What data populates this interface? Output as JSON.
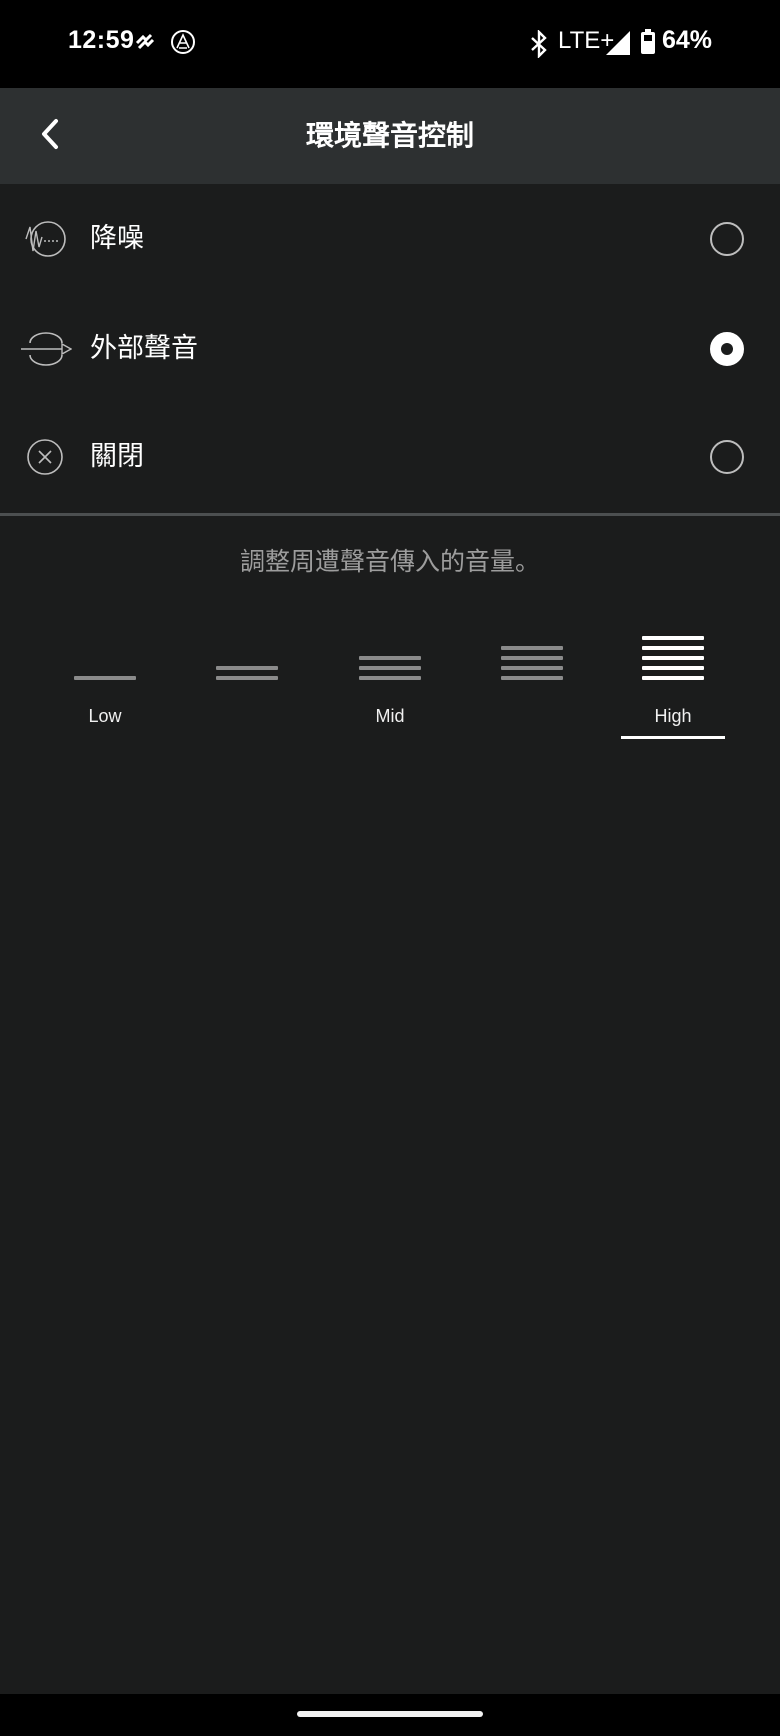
{
  "status_bar": {
    "time": "12:59",
    "network": "LTE+",
    "battery": "64%",
    "icons": [
      "notification-app-icon",
      "audio-technica-icon",
      "bluetooth-icon",
      "signal-icon",
      "battery-icon"
    ]
  },
  "app_bar": {
    "title": "環境聲音控制",
    "back_icon": "chevron-left-icon"
  },
  "modes": [
    {
      "label": "降噪",
      "icon": "noise-cancel-icon",
      "selected": false
    },
    {
      "label": "外部聲音",
      "icon": "hear-through-icon",
      "selected": true
    },
    {
      "label": "關閉",
      "icon": "off-x-icon",
      "selected": false
    }
  ],
  "hint": "調整周遭聲音傳入的音量。",
  "levels": {
    "items": [
      {
        "label": "Low",
        "bars": 1
      },
      {
        "label": "",
        "bars": 2
      },
      {
        "label": "Mid",
        "bars": 3
      },
      {
        "label": "",
        "bars": 4
      },
      {
        "label": "High",
        "bars": 5
      }
    ],
    "selected_index": 4
  },
  "colors": {
    "background": "#1b1c1c",
    "app_bar": "#2d3031",
    "hint_text": "#9d9d9d"
  }
}
